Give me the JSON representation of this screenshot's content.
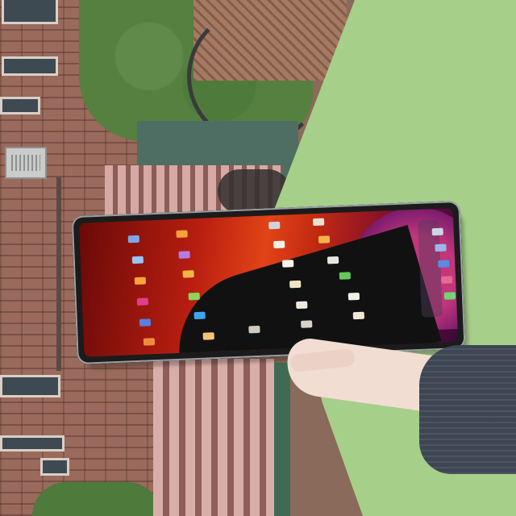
{
  "photo": {
    "subject": "",
    "colors": {
      "brick": "#9a6a5c",
      "green_wall": "#a6cf8a",
      "screen_red": "#e24316",
      "screen_magenta": "#c2367a",
      "sleeve": "#3d4652"
    }
  },
  "app_icons_visible": true
}
